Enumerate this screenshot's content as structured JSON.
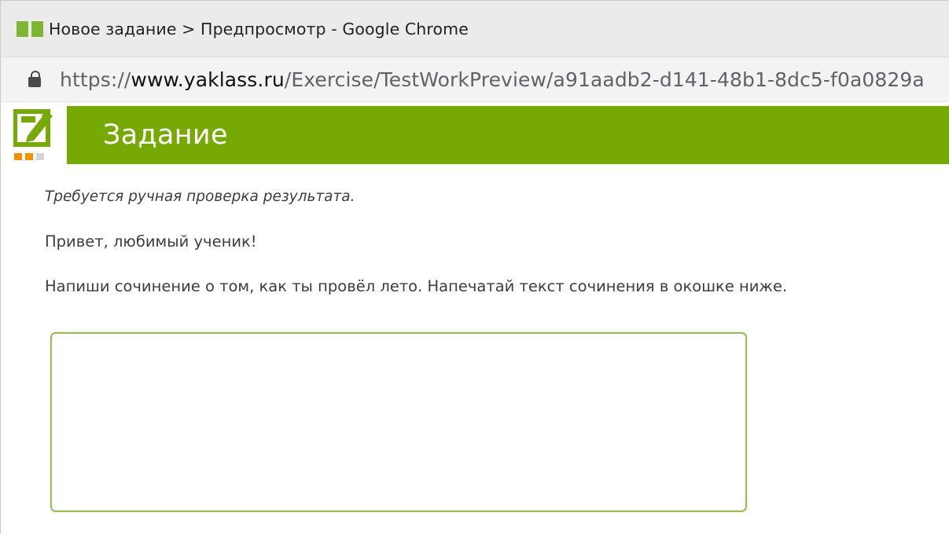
{
  "browser": {
    "window_title": "Новое задание > Предпросмотр - Google Chrome",
    "url": {
      "scheme": "https://",
      "host": "www.yaklass.ru",
      "path": "/Exercise/TestWorkPreview/a91aadb2-d141-48b1-8dc5-f0a0829a"
    },
    "icons": {
      "app_icon": "yaklass-favicon-icon",
      "lock": "lock-icon"
    }
  },
  "header": {
    "title": "Задание",
    "logo": "edit-task-icon",
    "color": "#77a904"
  },
  "content": {
    "note": "Требуется ручная проверка результата.",
    "greeting": "Привет, любимый ученик!",
    "instruction": "Напиши сочинение о том, как ты провёл лето. Напечатай текст сочинения в окошке ниже.",
    "answer_value": ""
  },
  "colors": {
    "accent": "#77a904",
    "answer_border": "#97bd50"
  }
}
